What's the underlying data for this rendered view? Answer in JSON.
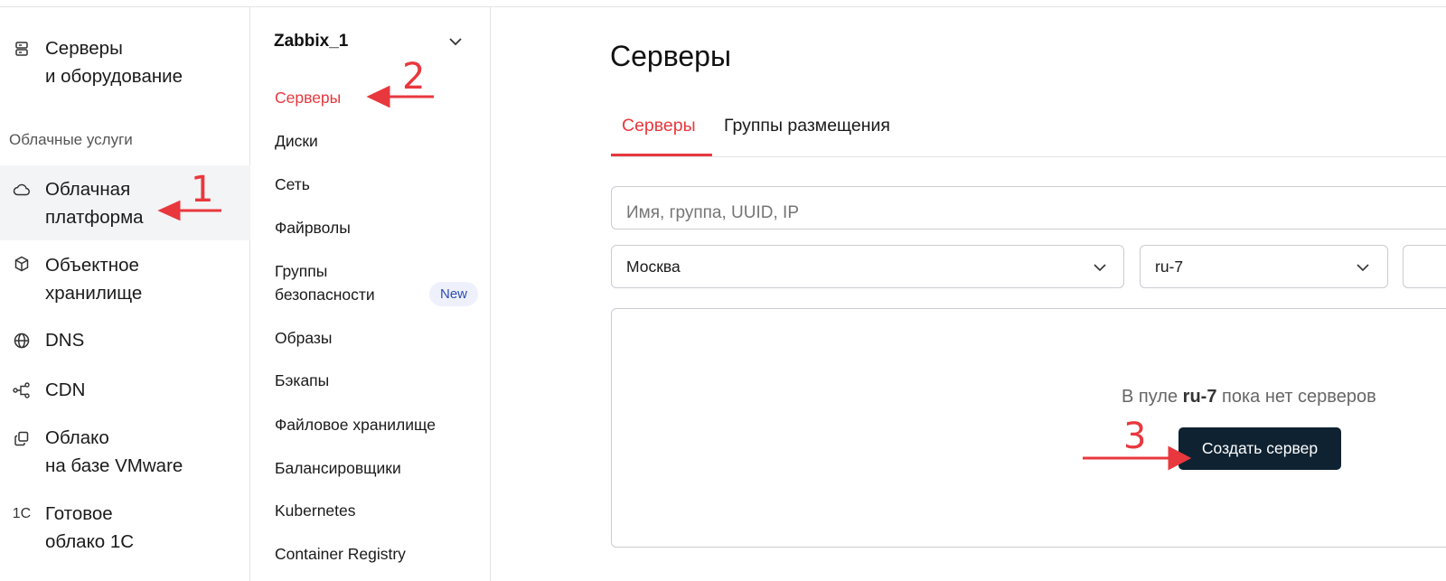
{
  "sidebar": {
    "items": [
      {
        "label": "Серверы\nи оборудование",
        "icon": "server-icon"
      },
      {
        "label": "Облачная\nплатформа",
        "icon": "cloud-icon",
        "active": true
      },
      {
        "label": "Объектное\nхранилище",
        "icon": "cube-icon"
      },
      {
        "label": "DNS",
        "icon": "globe-icon"
      },
      {
        "label": "CDN",
        "icon": "cdn-nodes-icon"
      },
      {
        "label": "Облако\nна базе VMware",
        "icon": "copy-layers-icon"
      },
      {
        "label": "Готовое\nоблако 1С",
        "icon": "onec-icon",
        "icon_text": "1С"
      }
    ],
    "section_label": "Облачные услуги"
  },
  "subnav": {
    "project": "Zabbix_1",
    "items": [
      {
        "label": "Серверы",
        "active": true
      },
      {
        "label": "Диски"
      },
      {
        "label": "Сеть"
      },
      {
        "label": "Файрволы"
      },
      {
        "label": "Группы\nбезопасности",
        "badge": "New"
      },
      {
        "label": "Образы"
      },
      {
        "label": "Бэкапы"
      },
      {
        "label": "Файловое хранилище"
      },
      {
        "label": "Балансировщики"
      },
      {
        "label": "Kubernetes"
      },
      {
        "label": "Container Registry"
      }
    ]
  },
  "main": {
    "title": "Серверы",
    "tabs": [
      {
        "label": "Серверы",
        "active": true
      },
      {
        "label": "Группы размещения"
      }
    ],
    "search_placeholder": "Имя, группа, UUID, IP",
    "region_select": "Москва",
    "pool_select": "ru-7",
    "empty": {
      "prefix": "В пуле",
      "pool": "ru-7",
      "suffix": "пока нет серверов"
    },
    "create_button": "Создать сервер"
  },
  "annotations": {
    "step1": "1",
    "step2": "2",
    "step3": "3",
    "color": "#e8383d"
  },
  "colors": {
    "accent": "#e8383d",
    "button_bg": "#0f2231",
    "badge_bg": "#eef1fb",
    "badge_text": "#2f4bb8"
  }
}
